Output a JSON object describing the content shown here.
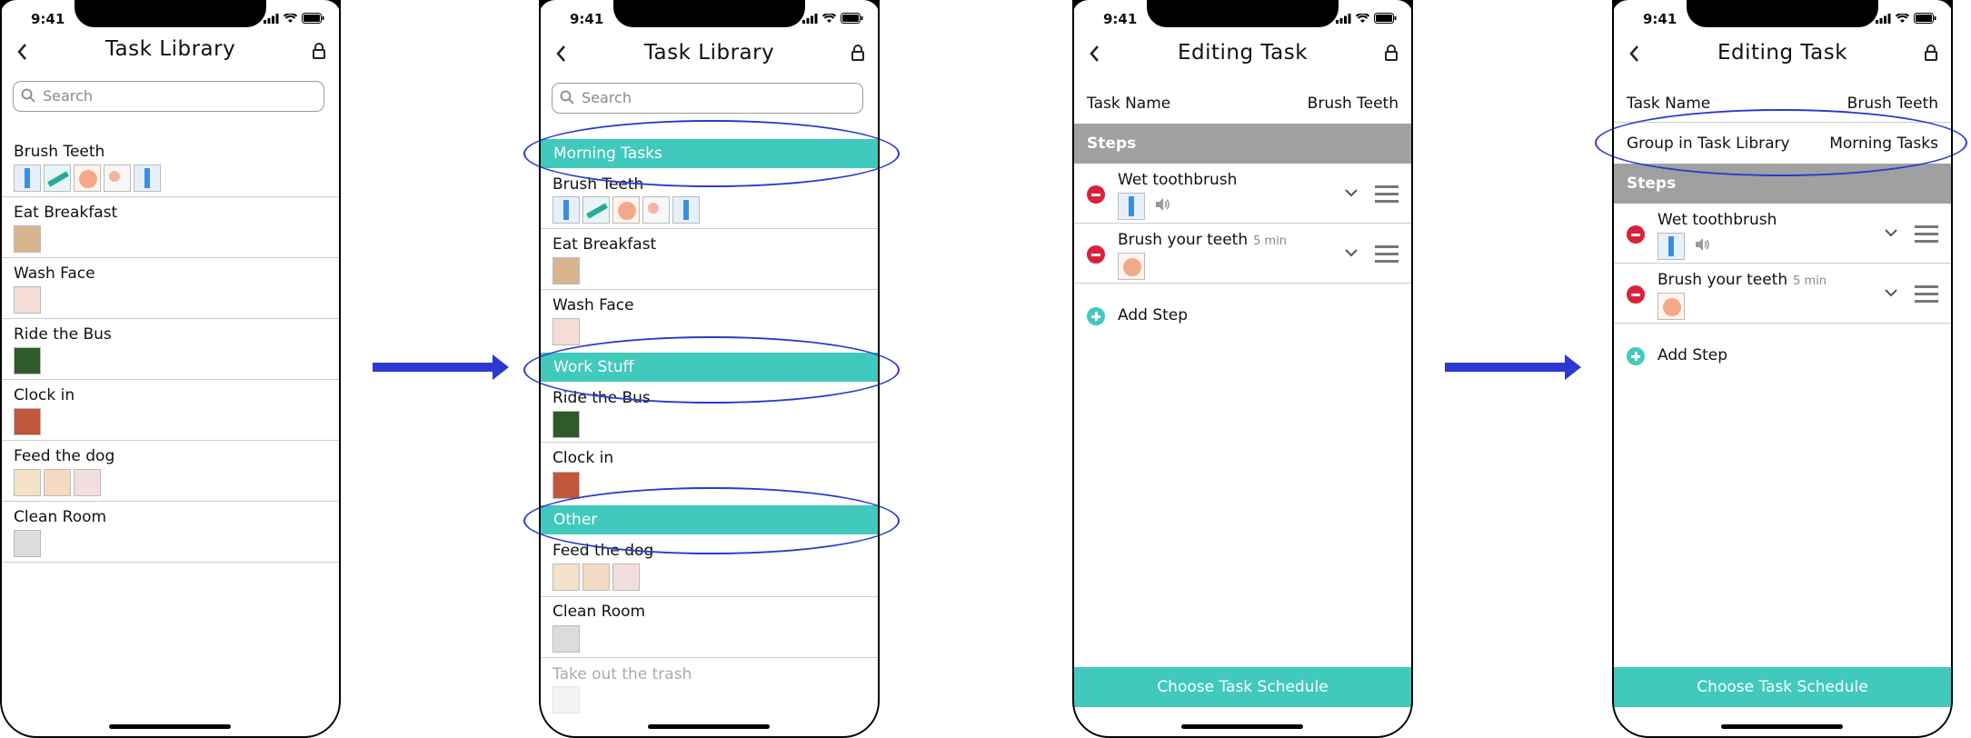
{
  "status": {
    "time": "9:41"
  },
  "screen1": {
    "title": "Task Library",
    "search_placeholder": "Search",
    "tasks": [
      {
        "name": "Brush Teeth",
        "thumb_count": 5
      },
      {
        "name": "Eat Breakfast",
        "thumb_count": 1
      },
      {
        "name": "Wash Face",
        "thumb_count": 1
      },
      {
        "name": "Ride the Bus",
        "thumb_count": 1
      },
      {
        "name": "Clock in",
        "thumb_count": 1
      },
      {
        "name": "Feed the dog",
        "thumb_count": 3
      },
      {
        "name": "Clean Room",
        "thumb_count": 1
      }
    ]
  },
  "screen2": {
    "title": "Task Library",
    "search_placeholder": "Search",
    "groups": [
      {
        "name": "Morning Tasks",
        "tasks": [
          "Brush Teeth",
          "Eat Breakfast",
          "Wash Face"
        ]
      },
      {
        "name": "Work Stuff",
        "tasks": [
          "Ride the Bus",
          "Clock in"
        ]
      },
      {
        "name": "Other",
        "tasks": [
          "Feed the dog",
          "Clean Room",
          "Take out the trash"
        ]
      }
    ]
  },
  "screen3": {
    "title": "Editing Task",
    "task_name_label": "Task Name",
    "task_name_value": "Brush Teeth",
    "steps_label": "Steps",
    "steps": [
      {
        "name": "Wet toothbrush",
        "duration": ""
      },
      {
        "name": "Brush your teeth",
        "duration": "5 min"
      }
    ],
    "add_step": "Add Step",
    "schedule_button": "Choose Task Schedule"
  },
  "screen4": {
    "title": "Editing Task",
    "task_name_label": "Task Name",
    "task_name_value": "Brush Teeth",
    "group_label": "Group in Task Library",
    "group_value": "Morning Tasks",
    "steps_label": "Steps",
    "steps": [
      {
        "name": "Wet toothbrush",
        "duration": ""
      },
      {
        "name": "Brush your teeth",
        "duration": "5 min"
      }
    ],
    "add_step": "Add Step",
    "schedule_button": "Choose Task Schedule"
  },
  "colors": {
    "accent": "#40c9bc",
    "annotation": "#2b39d0",
    "delete": "#d9213c",
    "steps_header": "#a0a0a0"
  }
}
